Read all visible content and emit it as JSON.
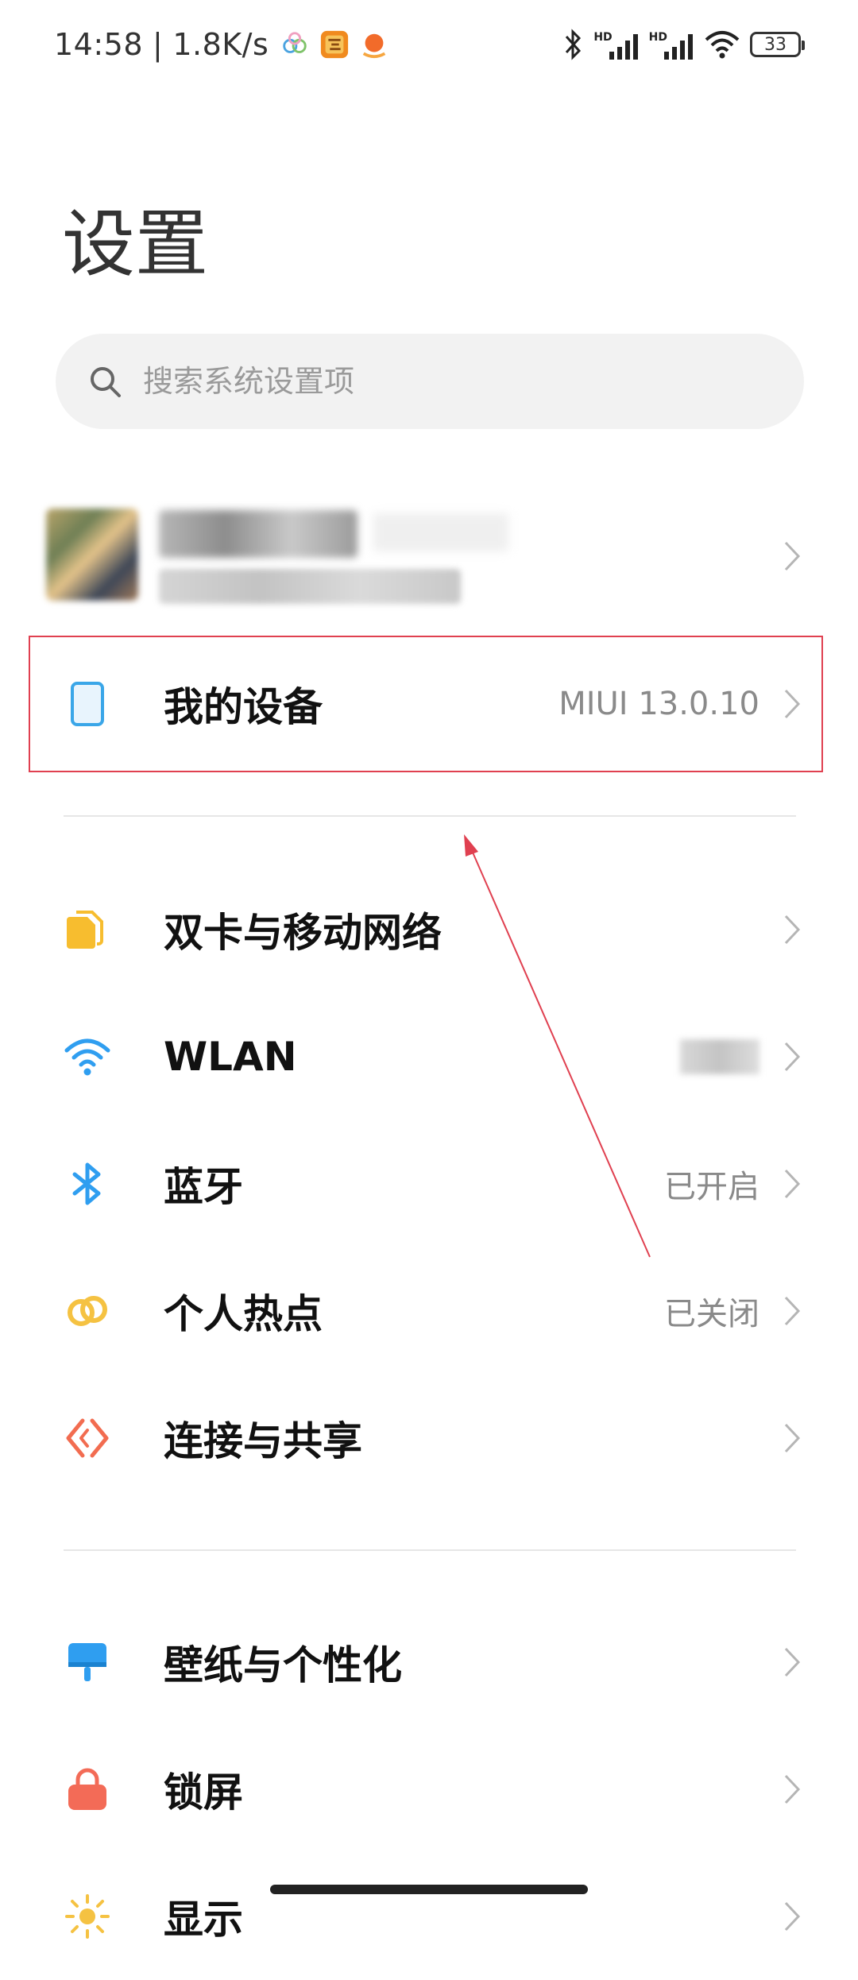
{
  "status_bar": {
    "time": "14:58",
    "separator": "|",
    "net_speed": "1.8K/s",
    "signal_label_1": "HD",
    "signal_label_2": "HD",
    "battery": "33"
  },
  "page_title": "设置",
  "search": {
    "placeholder": "搜索系统设置项"
  },
  "account": {
    "name": "",
    "subtitle": ""
  },
  "my_device": {
    "label": "我的设备",
    "value": "MIUI 13.0.10"
  },
  "connectivity": [
    {
      "label": "双卡与移动网络",
      "value": ""
    },
    {
      "label": "WLAN",
      "value": ""
    },
    {
      "label": "蓝牙",
      "value": "已开启"
    },
    {
      "label": "个人热点",
      "value": "已关闭"
    },
    {
      "label": "连接与共享",
      "value": ""
    }
  ],
  "personalization": [
    {
      "label": "壁纸与个性化",
      "value": ""
    },
    {
      "label": "锁屏",
      "value": ""
    },
    {
      "label": "显示",
      "value": ""
    }
  ],
  "colors": {
    "device_icon": "#3aa6e8",
    "sim_icon": "#f7bd2f",
    "wlan_icon": "#2f9ef0",
    "bluetooth_icon": "#2f9ef0",
    "hotspot_icon": "#f5c242",
    "share_icon": "#f26c50",
    "wallpaper_icon": "#2f9ef0",
    "lock_icon": "#f36b57",
    "display_icon": "#f5c242",
    "annotation": "#e04050"
  }
}
